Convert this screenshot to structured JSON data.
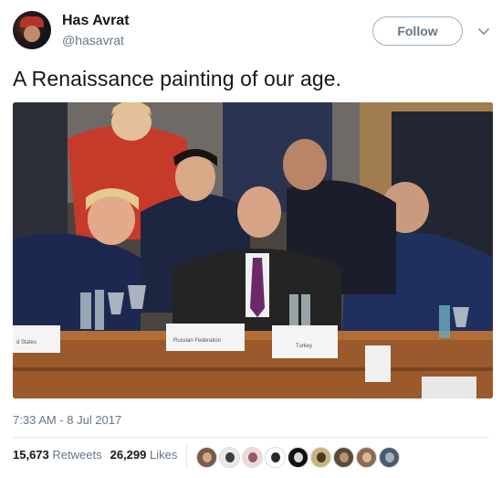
{
  "user": {
    "display_name": "Has Avrat",
    "handle": "@hasavrat"
  },
  "follow_label": "Follow",
  "tweet": {
    "text": "A Renaissance painting of our age."
  },
  "photo": {
    "placards": [
      "d States",
      "Russian Federation",
      "Turkey"
    ]
  },
  "timestamp": "7:33 AM - 8 Jul 2017",
  "stats": {
    "retweets_count": "15,673",
    "retweets_label": "Retweets",
    "likes_count": "26,299",
    "likes_label": "Likes"
  },
  "likers": [
    {
      "bg": "#7a5a48",
      "fg": "#d9b08c"
    },
    {
      "bg": "#e8e8e8",
      "fg": "#2a2a2a"
    },
    {
      "bg": "#f0d9d9",
      "fg": "#8a4a5a"
    },
    {
      "bg": "#ffffff",
      "fg": "#111111"
    },
    {
      "bg": "#111111",
      "fg": "#eeeeee"
    },
    {
      "bg": "#c9b37a",
      "fg": "#3a2a1a"
    },
    {
      "bg": "#5a4a3a",
      "fg": "#c49a70"
    },
    {
      "bg": "#8b6a52",
      "fg": "#e0c0a0"
    },
    {
      "bg": "#4a5a70",
      "fg": "#b0b8c8"
    }
  ],
  "colors": {
    "text": "#14171a",
    "secondary": "#657786",
    "border": "#e1e8ed"
  }
}
